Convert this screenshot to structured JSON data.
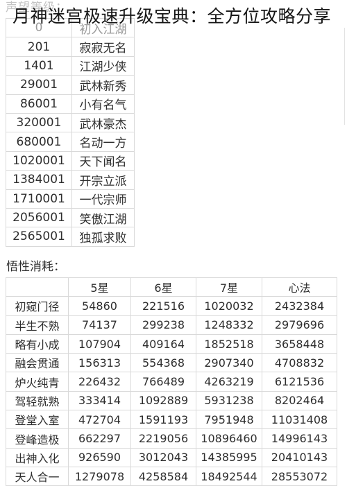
{
  "header": {
    "faded_label": "声望等级：",
    "title": "月神迷宫极速升级宝典：全方位攻略分享"
  },
  "reputation_table": {
    "rows": [
      {
        "points": "0",
        "rank": "初入江湖"
      },
      {
        "points": "201",
        "rank": "寂寂无名"
      },
      {
        "points": "1401",
        "rank": "江湖少侠"
      },
      {
        "points": "29001",
        "rank": "武林新秀"
      },
      {
        "points": "86001",
        "rank": "小有名气"
      },
      {
        "points": "320001",
        "rank": "武林豪杰"
      },
      {
        "points": "680001",
        "rank": "名动一方"
      },
      {
        "points": "1020001",
        "rank": "天下闻名"
      },
      {
        "points": "1384001",
        "rank": "开宗立派"
      },
      {
        "points": "1710001",
        "rank": "一代宗师"
      },
      {
        "points": "2056001",
        "rank": "笑傲江湖"
      },
      {
        "points": "2565001",
        "rank": "独孤求败"
      }
    ]
  },
  "insight_cost": {
    "label": "悟性消耗：",
    "columns": [
      "",
      "5星",
      "6星",
      "7星",
      "心法"
    ],
    "rows": [
      {
        "level": "初窥门径",
        "star5": "54860",
        "star6": "221516",
        "star7": "1020032",
        "xinfa": "2432384"
      },
      {
        "level": "半生不熟",
        "star5": "74137",
        "star6": "299238",
        "star7": "1248332",
        "xinfa": "2979696"
      },
      {
        "level": "略有小成",
        "star5": "107904",
        "star6": "409164",
        "star7": "1852518",
        "xinfa": "3658448"
      },
      {
        "level": "融会贯通",
        "star5": "156313",
        "star6": "554368",
        "star7": "2907340",
        "xinfa": "4708832"
      },
      {
        "level": "炉火纯青",
        "star5": "226432",
        "star6": "766489",
        "star7": "4263219",
        "xinfa": "6121536"
      },
      {
        "level": "驾轻就熟",
        "star5": "333414",
        "star6": "1092889",
        "star7": "5931238",
        "xinfa": "8202464"
      },
      {
        "level": "登堂入室",
        "star5": "472704",
        "star6": "1591193",
        "star7": "7951948",
        "xinfa": "11031408"
      },
      {
        "level": "登峰造极",
        "star5": "662297",
        "star6": "2219056",
        "star7": "10896460",
        "xinfa": "14996143"
      },
      {
        "level": "出神入化",
        "star5": "926590",
        "star6": "3012043",
        "star7": "14385995",
        "xinfa": "20410143"
      },
      {
        "level": "天人合一",
        "star5": "1279078",
        "star6": "4258584",
        "star7": "18492544",
        "xinfa": "28553072"
      }
    ]
  }
}
